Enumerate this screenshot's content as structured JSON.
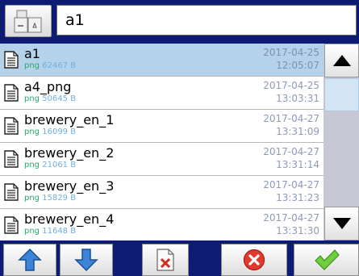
{
  "filename_input": {
    "value": "a1"
  },
  "files": [
    {
      "name": "a1",
      "type": "png",
      "size": "62467 B",
      "date": "2017-04-25",
      "time": "12:05:07",
      "selected": true
    },
    {
      "name": "a4_png",
      "type": "png",
      "size": "50645 B",
      "date": "2017-04-25",
      "time": "13:03:31",
      "selected": false
    },
    {
      "name": "brewery_en_1",
      "type": "png",
      "size": "16099 B",
      "date": "2017-04-27",
      "time": "13:31:09",
      "selected": false
    },
    {
      "name": "brewery_en_2",
      "type": "png",
      "size": "21061 B",
      "date": "2017-04-27",
      "time": "13:31:14",
      "selected": false
    },
    {
      "name": "brewery_en_3",
      "type": "png",
      "size": "15829 B",
      "date": "2017-04-27",
      "time": "13:31:23",
      "selected": false
    },
    {
      "name": "brewery_en_4",
      "type": "png",
      "size": "11648 B",
      "date": "2017-04-27",
      "time": "13:31:30",
      "selected": false
    }
  ],
  "colors": {
    "background": "#0d1b73",
    "selected_row": "#b4d2ea",
    "type_text": "#2aa86a",
    "size_text": "#6fb0dc",
    "date_text": "#8f9ab8"
  },
  "icons": {
    "folder_button": "folder-icon",
    "file": "document-icon",
    "scroll_up": "triangle-up-icon",
    "scroll_down": "triangle-down-icon",
    "move_up": "arrow-up-icon",
    "move_down": "arrow-down-icon",
    "delete": "delete-file-icon",
    "cancel": "cancel-icon",
    "ok": "checkmark-icon"
  }
}
